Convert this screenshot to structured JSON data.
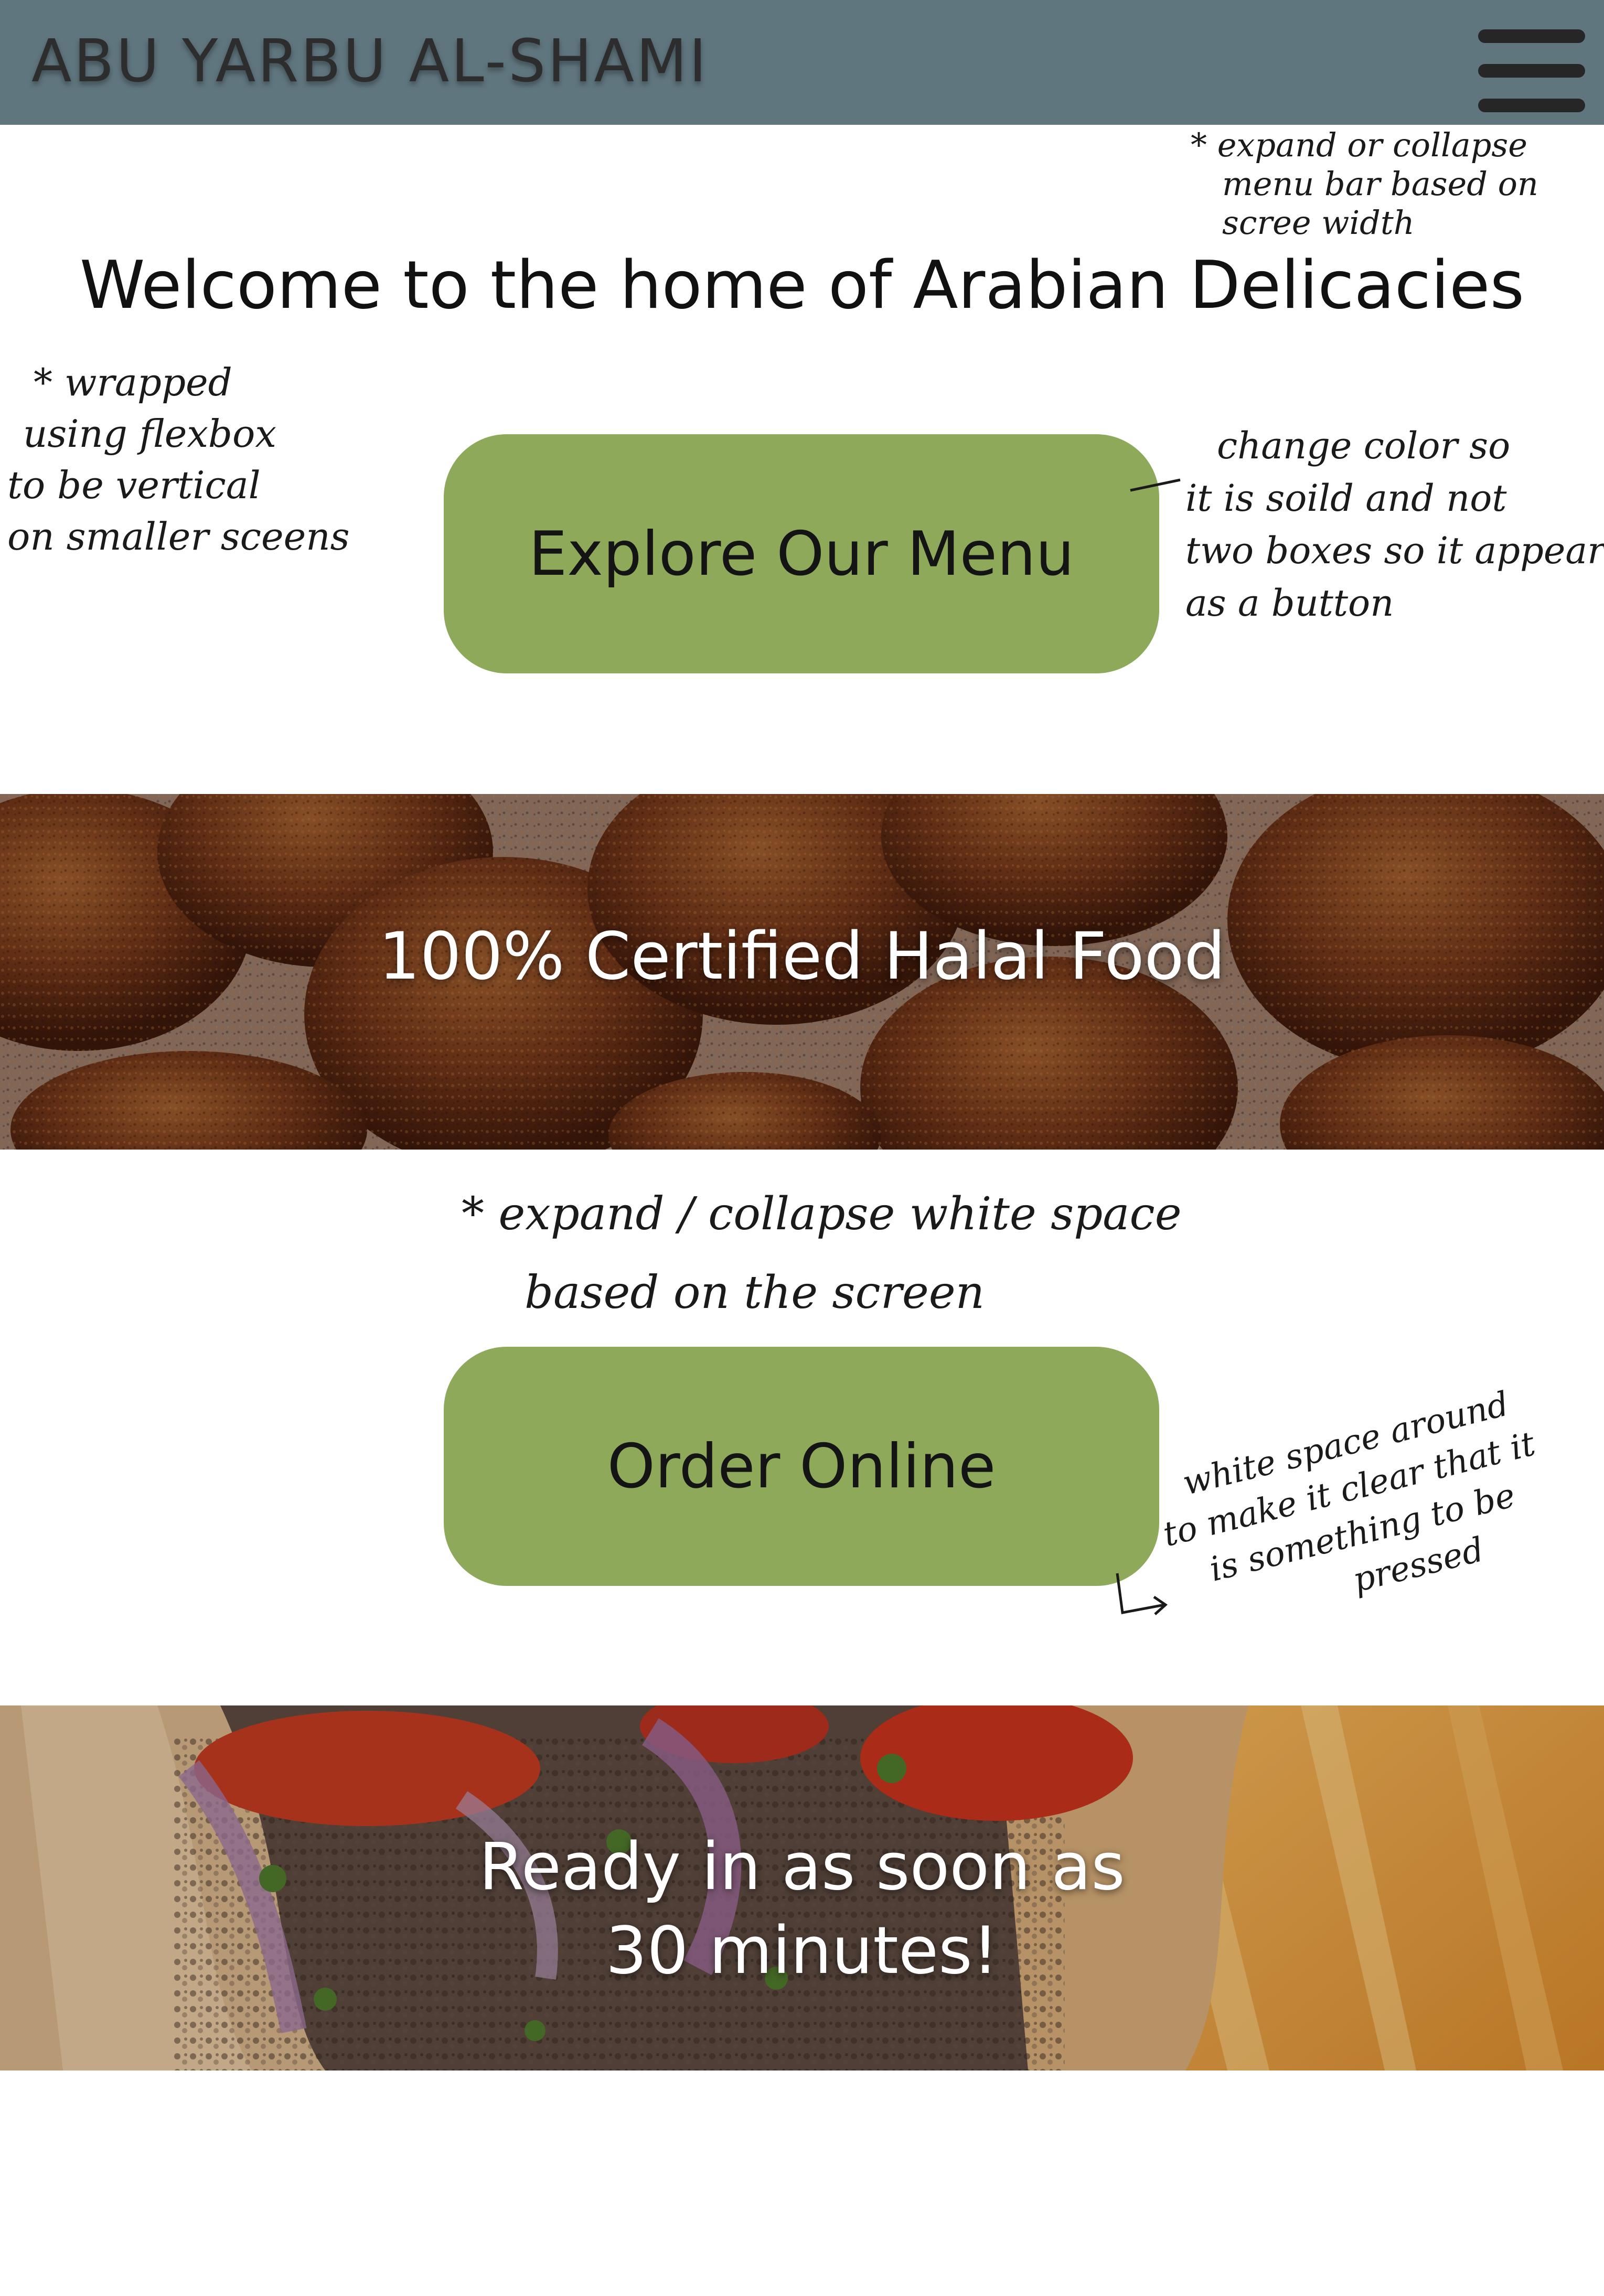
{
  "header": {
    "brand": "ABU YARBU AL-SHAMI",
    "menu_icon": "hamburger-menu-icon",
    "background": "#60767f"
  },
  "main": {
    "welcome_heading": "Welcome to the home of Arabian Delicacies",
    "explore_button_label": "Explore Our Menu",
    "order_button_label": "Order Online",
    "button_color": "#8fa95a"
  },
  "banners": {
    "halal": {
      "text": "100% Certified Halal Food",
      "image": "falafel-photo"
    },
    "ready": {
      "line1": "Ready in as soon as",
      "line2": "30 minutes!",
      "image": "shawarma-wrap-photo"
    }
  },
  "annotations": {
    "menu_bar": [
      "* expand or collapse",
      "menu bar based on",
      "scree width"
    ],
    "flexbox": [
      "* wrapped",
      "using flexbox",
      "to be vertical",
      "on smaller sceens"
    ],
    "button_color": [
      "change color so",
      "it is soild and not",
      "two boxes so it appears",
      "as a button"
    ],
    "white_space": [
      "* expand / collapse white space",
      "based on the screen"
    ],
    "button_space": [
      "white space around",
      "to make it clear that it",
      "is something to be",
      "pressed"
    ]
  }
}
